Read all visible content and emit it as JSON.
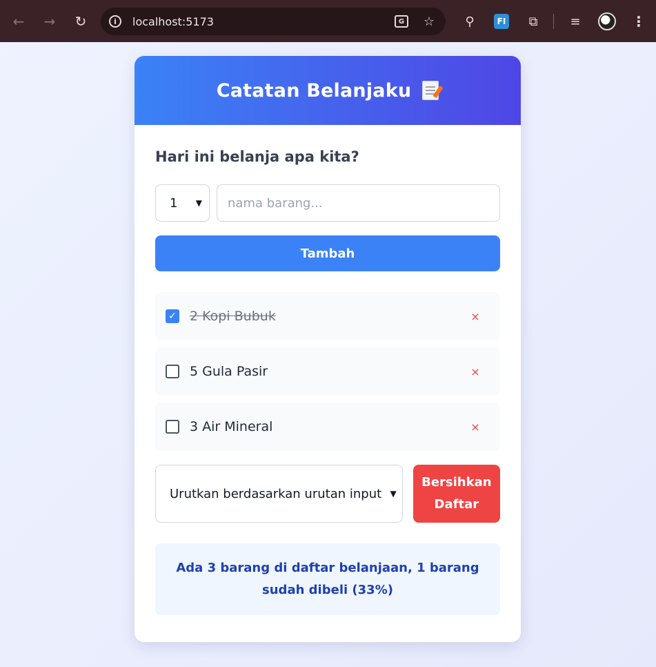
{
  "browser": {
    "url": "localhost:5173",
    "icons": [
      "back-icon",
      "forward-icon",
      "reload-icon",
      "site-info-icon",
      "translate-icon",
      "bookmark-star-icon",
      "zoom-icon",
      "extension-fi-icon",
      "extensions-puzzle-icon",
      "media-queue-icon",
      "profile-avatar",
      "menu-kebab-icon"
    ],
    "fi_label": "FI"
  },
  "header": {
    "title": "Catatan Belanjaku"
  },
  "form": {
    "prompt": "Hari ini belanja apa kita?",
    "quantity_value": "1",
    "name_placeholder": "nama barang...",
    "add_label": "Tambah"
  },
  "items": [
    {
      "label": "2 Kopi Bubuk",
      "checked": true
    },
    {
      "label": "5 Gula Pasir",
      "checked": false
    },
    {
      "label": "3 Air Mineral",
      "checked": false
    }
  ],
  "delete_symbol": "×",
  "controls": {
    "sort_value": "Urutkan berdasarkan urutan input",
    "clear_label_line1": "Bersihkan",
    "clear_label_line2": "Daftar"
  },
  "stats": {
    "text": "Ada 3 barang di daftar belanjaan, 1 barang sudah dibeli (33%)"
  },
  "colors": {
    "primary": "#3b82f6",
    "header_end": "#4f46e5",
    "danger": "#ef4444",
    "stats_text": "#1e40af",
    "stats_bg": "#eff6ff"
  }
}
